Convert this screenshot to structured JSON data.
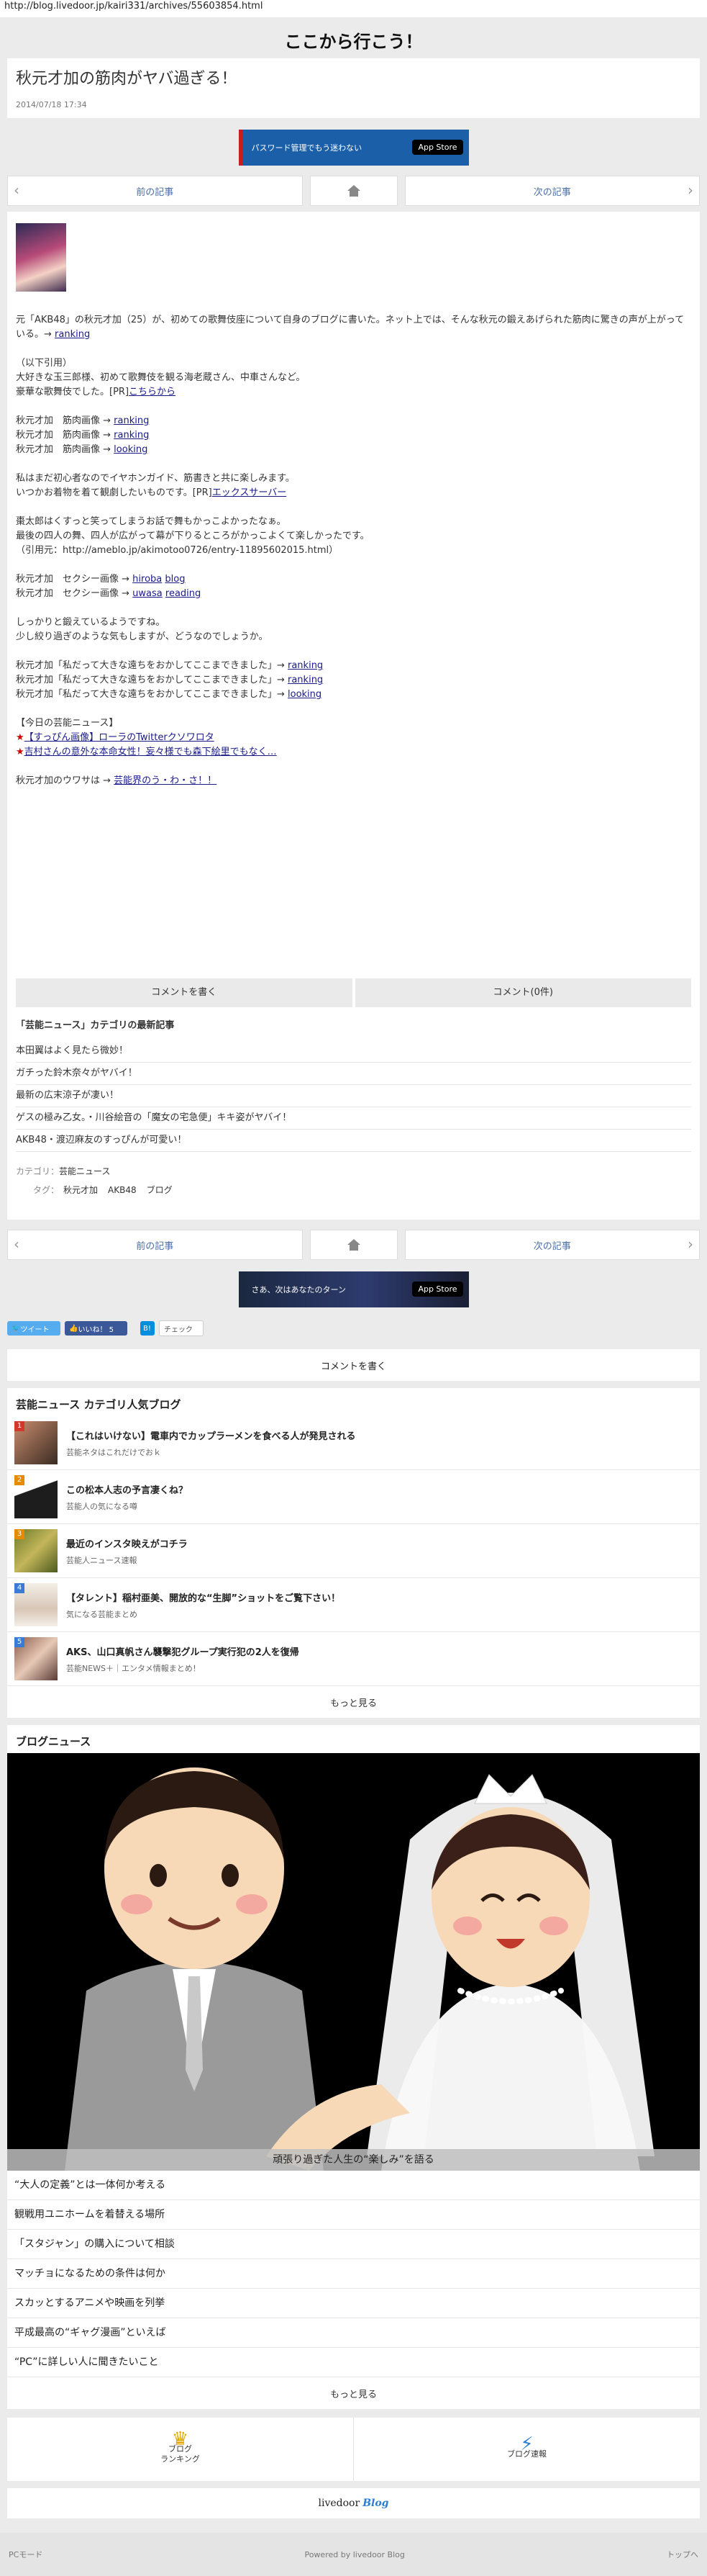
{
  "url": "http://blog.livedoor.jp/kairi331/archives/55603854.html",
  "site_title": "ここから行こう！",
  "article": {
    "title": "秋元才加の筋肉がヤバ過ぎる！",
    "date": "2014/07/18 17:34"
  },
  "banner1": {
    "text": "パスワード管理でもう迷わない",
    "store": "App Store"
  },
  "banner2": {
    "text": "さあ、次はあなたのターン",
    "store": "App Store"
  },
  "nav": {
    "prev": "前の記事",
    "next": "次の記事",
    "prev_chev": "‹",
    "next_chev": "›"
  },
  "body": {
    "intro": "元「AKB48」の秋元才加（25）が、初めての歌舞伎座について自身のブログに書いた。ネット上では、そんな秋元の鍛えあげられた筋肉に驚きの声が上がっている。→",
    "intro_link": "ranking",
    "quote_head": "（以下引用）",
    "quote1": "大好きな玉三郎様、初めて歌舞伎を観る海老蔵さん、中車さんなど。",
    "quote2": "豪華な歌舞伎でした。[PR]",
    "quote2_link": "こちらから",
    "muscle_label": "秋元才加　筋肉画像 →",
    "muscle_links": [
      "ranking",
      "ranking",
      "looking"
    ],
    "text1a": "私はまだ初心者なのでイヤホンガイド、筋書きと共に楽しみます。",
    "text1b": "いつかお着物を着て観劇したいものです。[PR]",
    "text1b_link": "エックスサーバー",
    "text2a": "棗太郎はくすっと笑ってしまうお話で舞もかっこよかったなぁ。",
    "text2b": "最後の四人の舞、四人が広がって幕が下りるところがかっこよくて楽しかったです。",
    "text2c": "（引用元：http://ameblo.jp/akimotoo0726/entry-11895602015.html）",
    "sexy_label": "秋元才加　セクシー画像 →",
    "sexy_links": [
      [
        "hiroba",
        "blog"
      ],
      [
        "uwasa",
        "reading"
      ]
    ],
    "text3a": "しっかりと鍛えているようですね。",
    "text3b": "少し絞り過ぎのような気もしますが、どうなのでしょうか。",
    "words_label": "秋元才加「私だって大きな遠ちをおかしてここまできました」→",
    "words_links": [
      "ranking",
      "ranking",
      "looking"
    ],
    "today_head": "【今日の芸能ニュース】",
    "today1": "【すっぴん画像】ローラのTwitterクソワロタ",
    "today2": "吉村さんの意外な本命女性！妄々様でも森下絵里でもなく…",
    "rumor_label": "秋元才加のウワサは →",
    "rumor_link": "芸能界のう・わ・さ！！"
  },
  "comments": {
    "write": "コメントを書く",
    "count": "コメント(0件)"
  },
  "recent": {
    "heading": "「芸能ニュース」カテゴリの最新記事",
    "items": [
      "本田翼はよく見たら微妙！",
      "ガチった鈴木奈々がヤバイ！",
      "最新の広末涼子が凄い！",
      "ゲスの極み乙女。・川谷絵音の「魔女の宅急便」キキ姿がヤバイ！",
      "AKB48・渡辺麻友のすっぴんが可愛い！"
    ]
  },
  "meta": {
    "category_label": "カテゴリ：",
    "category": "芸能ニュース",
    "tags_label": "タグ：",
    "tags": [
      "秋元才加",
      "AKB48",
      "ブログ"
    ]
  },
  "social": {
    "tweet": "ツイート",
    "like": "いいね！ 5",
    "hatena": "B!",
    "check": "チェック"
  },
  "write_comment": "コメントを書く",
  "popular": {
    "heading": "芸能ニュース カテゴリ人気ブログ",
    "items": [
      {
        "rank": "1",
        "title": "【これはいけない】電車内でカップラーメンを食べる人が発見される",
        "source": "芸能ネタはこれだけでおｋ"
      },
      {
        "rank": "2",
        "title": "この松本人志の予言凄くね？",
        "source": "芸能人の気になる噂"
      },
      {
        "rank": "3",
        "title": "最近のインスタ映えがコチラ",
        "source": "芸能人ニュース速報"
      },
      {
        "rank": "4",
        "title": "【タレント】稲村亜美、開放的な“生脚”ショットをご覧下さい！",
        "source": "気になる芸能まとめ"
      },
      {
        "rank": "5",
        "title": "AKS、山口真帆さん襲撃犯グループ実行犯の2人を復帰",
        "source": "芸能NEWS＋｜エンタメ情報まとめ！"
      }
    ],
    "more": "もっと見る"
  },
  "blog_news": {
    "heading": "ブログニュース",
    "caption": "頑張り過ぎた人生の“楽しみ”を語る",
    "items": [
      "“大人の定義”とは一体何か考える",
      "観戦用ユニホームを着替える場所",
      "「スタジャン」の購入について相談",
      "マッチョになるための条件は何か",
      "スカッとするアニメや映画を列挙",
      "平成最高の“ギャグ漫画”といえば",
      "“PC”に詳しい人に聞きたいこと"
    ],
    "more": "もっと見る"
  },
  "footer_buttons": {
    "ranking": "ブログ\nランキング",
    "ranking_l1": "ブログ",
    "ranking_l2": "ランキング",
    "news": "ブログ速報"
  },
  "logo": {
    "livedoor": "livedoor",
    "blog": "Blog"
  },
  "footer": {
    "pc_mode": "PCモード",
    "powered": "Powered by livedoor Blog",
    "top": "トップへ"
  }
}
